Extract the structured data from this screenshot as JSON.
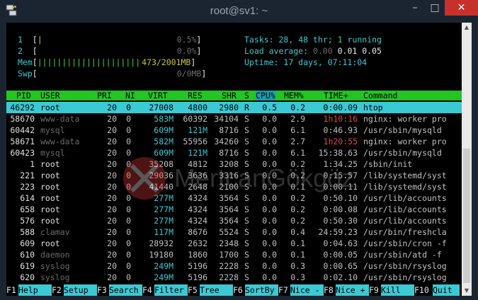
{
  "window": {
    "title": "root@sv1: ~",
    "minimize": "–",
    "maximize": "□",
    "close": "✕"
  },
  "meters": {
    "cpu1": {
      "label": "1",
      "open": "[",
      "bar": "|",
      "value": "0.5%",
      "close": "]"
    },
    "cpu2": {
      "label": "2",
      "open": "[",
      "bar": "",
      "value": "0.0%",
      "close": "]"
    },
    "mem": {
      "label": "Mem",
      "open": "[",
      "bar": "|||||||||||||||||||||",
      "value": "473/2001MB",
      "close": "]"
    },
    "swp": {
      "label": "Swp",
      "open": "[",
      "bar": "",
      "value": "0/0MB",
      "close": "]"
    }
  },
  "summary": {
    "tasks_label": "Tasks:",
    "tasks": "28,",
    "thr": "48",
    "thr_label": "thr;",
    "running": "1",
    "running_label": "running",
    "load_label": "Load average:",
    "load1": "0.00",
    "load5": "0.01",
    "load15": "0.05",
    "uptime_label": "Uptime:",
    "uptime": "17 days, 07:11:04"
  },
  "columns": [
    "PID",
    "USER",
    "PRI",
    "NI",
    "VIRT",
    "RES",
    "SHR",
    "S",
    "CPU%",
    "MEM%",
    "TIME+",
    "Command"
  ],
  "processes": [
    [
      "46292",
      "root",
      "20",
      "0",
      "27008",
      "4800",
      "2980",
      "R",
      "0.5",
      "0.2",
      "0:00.09",
      "htop"
    ],
    [
      "58670",
      "www-data",
      "20",
      "0",
      "583M",
      "60392",
      "34104",
      "S",
      "0.0",
      "2.9",
      "1h10:16",
      "nginx: worker pro"
    ],
    [
      "60442",
      "mysql",
      "20",
      "0",
      "609M",
      "121M",
      "8716",
      "S",
      "0.0",
      "6.1",
      "0:46.93",
      "/usr/sbin/mysqld"
    ],
    [
      "58671",
      "www-data",
      "20",
      "0",
      "582M",
      "55956",
      "34260",
      "S",
      "0.0",
      "2.7",
      "1h20:55",
      "nginx: worker pro"
    ],
    [
      "60423",
      "mysql",
      "20",
      "0",
      "609M",
      "121M",
      "8716",
      "S",
      "0.0",
      "6.1",
      "15:38.63",
      "/usr/sbin/mysqld"
    ],
    [
      "1",
      "root",
      "20",
      "0",
      "35208",
      "4812",
      "3208",
      "S",
      "0.0",
      "0.2",
      "1:34.25",
      "/sbin/init"
    ],
    [
      "221",
      "root",
      "20",
      "0",
      "29036",
      "3636",
      "3316",
      "S",
      "0.0",
      "0.2",
      "0:15.57",
      "/lib/systemd/syst"
    ],
    [
      "223",
      "root",
      "20",
      "0",
      "41440",
      "2648",
      "2100",
      "S",
      "0.0",
      "0.1",
      "0:00.11",
      "/lib/systemd/syst"
    ],
    [
      "614",
      "root",
      "20",
      "0",
      "277M",
      "4324",
      "3564",
      "S",
      "0.0",
      "0.2",
      "0:50.10",
      "/usr/lib/accounts"
    ],
    [
      "658",
      "root",
      "20",
      "0",
      "277M",
      "4324",
      "3564",
      "S",
      "0.0",
      "0.2",
      "0:00.08",
      "/usr/lib/accounts"
    ],
    [
      "576",
      "root",
      "20",
      "0",
      "277M",
      "4324",
      "3564",
      "S",
      "0.0",
      "0.2",
      "0:50.30",
      "/usr/lib/accounts"
    ],
    [
      "588",
      "clamav",
      "20",
      "0",
      "117M",
      "8676",
      "5524",
      "S",
      "0.0",
      "0.4",
      "24:59.23",
      "/usr/bin/freshcla"
    ],
    [
      "609",
      "root",
      "20",
      "0",
      "28932",
      "2632",
      "2348",
      "S",
      "0.0",
      "0.1",
      "0:04.63",
      "/usr/sbin/cron -f"
    ],
    [
      "610",
      "daemon",
      "20",
      "0",
      "19180",
      "1860",
      "1700",
      "S",
      "0.0",
      "0.1",
      "0:00.05",
      "/usr/sbin/atd -f"
    ],
    [
      "619",
      "syslog",
      "20",
      "0",
      "249M",
      "5196",
      "2228",
      "S",
      "0.0",
      "0.3",
      "0:00.65",
      "/usr/sbin/rsyslog"
    ],
    [
      "620",
      "syslog",
      "20",
      "0",
      "249M",
      "5196",
      "2228",
      "S",
      "0.0",
      "0.3",
      "0:02.10",
      "/usr/sbin/rsyslog"
    ]
  ],
  "footer": [
    {
      "key": "F1",
      "label": "Help"
    },
    {
      "key": "F2",
      "label": "Setup"
    },
    {
      "key": "F3",
      "label": "Search"
    },
    {
      "key": "F4",
      "label": "Filter"
    },
    {
      "key": "F5",
      "label": "Tree"
    },
    {
      "key": "F6",
      "label": "SortBy"
    },
    {
      "key": "F7",
      "label": "Nice -"
    },
    {
      "key": "F8",
      "label": "Nice +"
    },
    {
      "key": "F9",
      "label": "Kill"
    },
    {
      "key": "F10",
      "label": "Quit"
    }
  ],
  "watermark": {
    "text": "MertcanGökgöz",
    "accent": "#e03a3a"
  },
  "colors": {
    "header_bar": "#22c522",
    "selected_row": "#3bc9d4",
    "sort_column": "#12a0b0",
    "close_button": "#c7302b"
  }
}
